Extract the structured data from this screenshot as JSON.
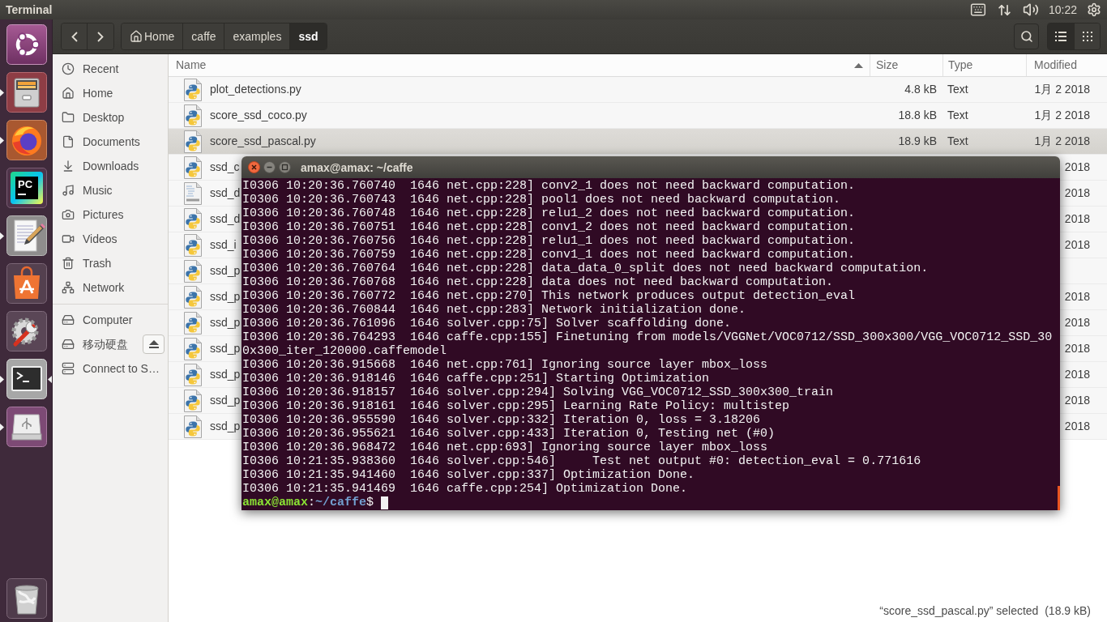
{
  "top_panel": {
    "app_title": "Terminal",
    "clock": "10:22"
  },
  "launcher": [
    {
      "kind": "dash",
      "running": false,
      "focused": false
    },
    {
      "kind": "files",
      "running": true,
      "focused": false
    },
    {
      "kind": "browser",
      "running": true,
      "focused": false
    },
    {
      "kind": "ide",
      "running": false,
      "focused": false,
      "logo_text": "PC"
    },
    {
      "kind": "editor",
      "running": true,
      "focused": false
    },
    {
      "kind": "store",
      "running": false,
      "focused": false
    },
    {
      "kind": "settings",
      "running": false,
      "focused": false
    },
    {
      "kind": "terminal",
      "running": true,
      "focused": true
    },
    {
      "kind": "usb",
      "running": true,
      "focused": false
    }
  ],
  "toolbar": {
    "breadcrumbs": [
      {
        "kind": "home",
        "label": "Home",
        "selected": false
      },
      {
        "kind": "folder",
        "label": "caffe",
        "selected": false
      },
      {
        "kind": "folder",
        "label": "examples",
        "selected": false
      },
      {
        "kind": "folder",
        "label": "ssd",
        "selected": true
      }
    ],
    "view_modes": [
      {
        "kind": "list",
        "selected": true
      },
      {
        "kind": "grid",
        "selected": false
      }
    ]
  },
  "sidebar": {
    "places": [
      {
        "kind": "recent",
        "label": "Recent",
        "selected": false
      },
      {
        "kind": "home",
        "label": "Home",
        "selected": false
      },
      {
        "kind": "desktop",
        "label": "Desktop",
        "selected": false
      },
      {
        "kind": "documents",
        "label": "Documents",
        "selected": false
      },
      {
        "kind": "downloads",
        "label": "Downloads",
        "selected": false
      },
      {
        "kind": "music",
        "label": "Music",
        "selected": false
      },
      {
        "kind": "pictures",
        "label": "Pictures",
        "selected": false
      },
      {
        "kind": "videos",
        "label": "Videos",
        "selected": false
      },
      {
        "kind": "trash",
        "label": "Trash",
        "selected": false
      },
      {
        "kind": "network",
        "label": "Network",
        "selected": false
      }
    ],
    "devices": [
      {
        "kind": "computer",
        "label": "Computer",
        "ejectable": false,
        "selected": false
      },
      {
        "kind": "drive",
        "label": "移动硬盘",
        "ejectable": true,
        "selected": false
      },
      {
        "kind": "server",
        "label": "Connect to S…",
        "ejectable": false,
        "selected": false
      }
    ]
  },
  "file_list": {
    "columns": [
      {
        "label": "Name",
        "sorted": true
      },
      {
        "label": "Size",
        "sorted": false
      },
      {
        "label": "Type",
        "sorted": false
      },
      {
        "label": "Modified",
        "sorted": false
      }
    ],
    "rows": [
      {
        "kind": "python",
        "name": "plot_detections.py",
        "size": "4.8 kB",
        "type": "Text",
        "modified": "1月 2 2018",
        "selected": false
      },
      {
        "kind": "python",
        "name": "score_ssd_coco.py",
        "size": "18.8 kB",
        "type": "Text",
        "modified": "1月 2 2018",
        "selected": false
      },
      {
        "kind": "python",
        "name": "score_ssd_pascal.py",
        "size": "18.9 kB",
        "type": "Text",
        "modified": "1月 2 2018",
        "selected": true
      },
      {
        "kind": "python",
        "name": "ssd_c",
        "modified": "2018",
        "selected": false
      },
      {
        "kind": "source",
        "name": "ssd_d",
        "modified": "2018",
        "selected": false
      },
      {
        "kind": "python",
        "name": "ssd_d",
        "modified": "2018",
        "selected": false
      },
      {
        "kind": "python",
        "name": "ssd_i",
        "modified": "2018",
        "selected": false
      },
      {
        "kind": "python",
        "name": "ssd_p",
        "selected": false
      },
      {
        "kind": "python",
        "name": "ssd_p",
        "modified": "2018",
        "selected": false
      },
      {
        "kind": "python",
        "name": "ssd_p",
        "modified": "2018",
        "selected": false
      },
      {
        "kind": "python",
        "name": "ssd_p",
        "modified": "2018",
        "selected": false
      },
      {
        "kind": "python",
        "name": "ssd_p",
        "modified": "2018",
        "selected": false
      },
      {
        "kind": "python",
        "name": "ssd_p",
        "modified": "2018",
        "selected": false
      },
      {
        "kind": "python",
        "name": "ssd_p",
        "modified": "2018",
        "selected": false
      }
    ]
  },
  "status_bar": {
    "text": "“score_ssd_pascal.py” selected  (18.9 kB)"
  },
  "terminal": {
    "title": "amax@amax: ~/caffe",
    "lines": [
      "I0306 10:20:36.760740  1646 net.cpp:228] conv2_1 does not need backward computation.",
      "I0306 10:20:36.760743  1646 net.cpp:228] pool1 does not need backward computation.",
      "I0306 10:20:36.760748  1646 net.cpp:228] relu1_2 does not need backward computation.",
      "I0306 10:20:36.760751  1646 net.cpp:228] conv1_2 does not need backward computation.",
      "I0306 10:20:36.760756  1646 net.cpp:228] relu1_1 does not need backward computation.",
      "I0306 10:20:36.760759  1646 net.cpp:228] conv1_1 does not need backward computation.",
      "I0306 10:20:36.760764  1646 net.cpp:228] data_data_0_split does not need backward computation.",
      "I0306 10:20:36.760768  1646 net.cpp:228] data does not need backward computation.",
      "I0306 10:20:36.760772  1646 net.cpp:270] This network produces output detection_eval",
      "I0306 10:20:36.760844  1646 net.cpp:283] Network initialization done.",
      "I0306 10:20:36.761096  1646 solver.cpp:75] Solver scaffolding done.",
      "I0306 10:20:36.764293  1646 caffe.cpp:155] Finetuning from models/VGGNet/VOC0712/SSD_300x300/VGG_VOC0712_SSD_30",
      "0x300_iter_120000.caffemodel",
      "I0306 10:20:36.915668  1646 net.cpp:761] Ignoring source layer mbox_loss",
      "I0306 10:20:36.918146  1646 caffe.cpp:251] Starting Optimization",
      "I0306 10:20:36.918157  1646 solver.cpp:294] Solving VGG_VOC0712_SSD_300x300_train",
      "I0306 10:20:36.918161  1646 solver.cpp:295] Learning Rate Policy: multistep",
      "I0306 10:20:36.955590  1646 solver.cpp:332] Iteration 0, loss = 3.18206",
      "I0306 10:20:36.955621  1646 solver.cpp:433] Iteration 0, Testing net (#0)",
      "I0306 10:20:36.968472  1646 net.cpp:693] Ignoring source layer mbox_loss",
      "I0306 10:21:35.938360  1646 solver.cpp:546]     Test net output #0: detection_eval = 0.771616",
      "I0306 10:21:35.941460  1646 solver.cpp:337] Optimization Done.",
      "I0306 10:21:35.941469  1646 caffe.cpp:254] Optimization Done."
    ],
    "prompt": {
      "user_host": "amax@amax",
      "separator": ":",
      "path": "~/caffe",
      "symbol": "$"
    }
  }
}
